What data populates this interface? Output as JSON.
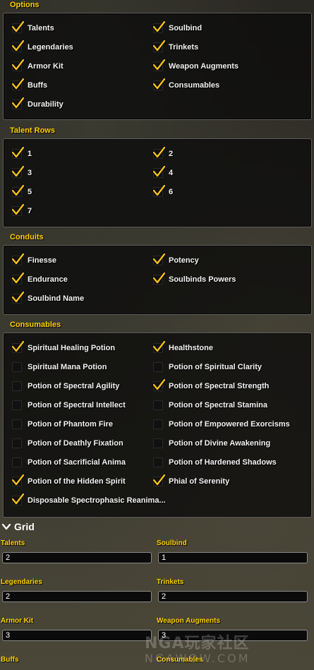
{
  "sections": {
    "options": {
      "title": "Options",
      "items": [
        {
          "label": "Talents",
          "checked": true
        },
        {
          "label": "Soulbind",
          "checked": true
        },
        {
          "label": "Legendaries",
          "checked": true
        },
        {
          "label": "Trinkets",
          "checked": true
        },
        {
          "label": "Armor Kit",
          "checked": true
        },
        {
          "label": "Weapon Augments",
          "checked": true
        },
        {
          "label": "Buffs",
          "checked": true
        },
        {
          "label": "Consumables",
          "checked": true
        },
        {
          "label": "Durability",
          "checked": true
        }
      ]
    },
    "talent_rows": {
      "title": "Talent Rows",
      "items": [
        {
          "label": "1",
          "checked": true
        },
        {
          "label": "2",
          "checked": true
        },
        {
          "label": "3",
          "checked": true
        },
        {
          "label": "4",
          "checked": true
        },
        {
          "label": "5",
          "checked": true
        },
        {
          "label": "6",
          "checked": true
        },
        {
          "label": "7",
          "checked": true
        }
      ]
    },
    "conduits": {
      "title": "Conduits",
      "items": [
        {
          "label": "Finesse",
          "checked": true
        },
        {
          "label": "Potency",
          "checked": true
        },
        {
          "label": "Endurance",
          "checked": true
        },
        {
          "label": "Soulbinds Powers",
          "checked": true
        },
        {
          "label": "Soulbind Name",
          "checked": true
        }
      ]
    },
    "consumables": {
      "title": "Consumables",
      "items": [
        {
          "label": "Spiritual Healing Potion",
          "checked": true
        },
        {
          "label": "Healthstone",
          "checked": true
        },
        {
          "label": "Spiritual Mana Potion",
          "checked": false
        },
        {
          "label": "Potion of Spiritual Clarity",
          "checked": false
        },
        {
          "label": "Potion of Spectral Agility",
          "checked": false
        },
        {
          "label": "Potion of Spectral Strength",
          "checked": true
        },
        {
          "label": "Potion of Spectral Intellect",
          "checked": false
        },
        {
          "label": "Potion of Spectral Stamina",
          "checked": false
        },
        {
          "label": "Potion of Phantom Fire",
          "checked": false
        },
        {
          "label": "Potion of Empowered Exorcisms",
          "checked": false
        },
        {
          "label": "Potion of Deathly Fixation",
          "checked": false
        },
        {
          "label": "Potion of Divine Awakening",
          "checked": false
        },
        {
          "label": "Potion of Sacrificial Anima",
          "checked": false
        },
        {
          "label": "Potion of Hardened Shadows",
          "checked": false
        },
        {
          "label": "Potion of the Hidden Spirit",
          "checked": true
        },
        {
          "label": "Phial of Serenity",
          "checked": true
        },
        {
          "label": "Disposable Spectrophasic Reanima...",
          "checked": true
        }
      ]
    }
  },
  "grid": {
    "header_label": "Grid",
    "expanded": true,
    "fields": [
      {
        "label": "Talents",
        "value": "2"
      },
      {
        "label": "Soulbind",
        "value": "1"
      },
      {
        "label": "Legendaries",
        "value": "2"
      },
      {
        "label": "Trinkets",
        "value": "2"
      },
      {
        "label": "Armor Kit",
        "value": "3"
      },
      {
        "label": "Weapon Augments",
        "value": "3"
      },
      {
        "label": "Buffs",
        "value": ""
      },
      {
        "label": "Consumables",
        "value": ""
      }
    ]
  },
  "watermark": {
    "line1": "NGA玩家社区",
    "line2": "NGAWOW.COM"
  },
  "colors": {
    "header_gold": "#ffd100",
    "check_gold": "#f6c21c",
    "panel_bg": "#0a0a0a"
  }
}
